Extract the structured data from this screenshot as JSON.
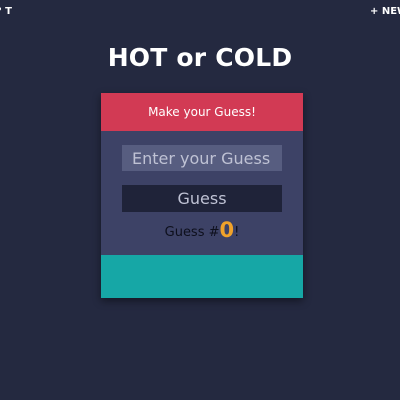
{
  "nav": {
    "left_label": "T ?",
    "new_game_label": "+ NEW GAME"
  },
  "title": "HOT or COLD",
  "card": {
    "header": "Make your Guess!",
    "input_placeholder": "Enter your Guess",
    "input_value": "",
    "button_label": "Guess",
    "count_prefix": "Guess #",
    "count_value": "0",
    "count_suffix": "!",
    "feedback_text": ""
  },
  "colors": {
    "background": "#242940",
    "card": "#3d4266",
    "header": "#d23a54",
    "input": "#575d80",
    "button": "#1f2339",
    "count_highlight": "#f0a22a",
    "feedback": "#16a7a6"
  }
}
